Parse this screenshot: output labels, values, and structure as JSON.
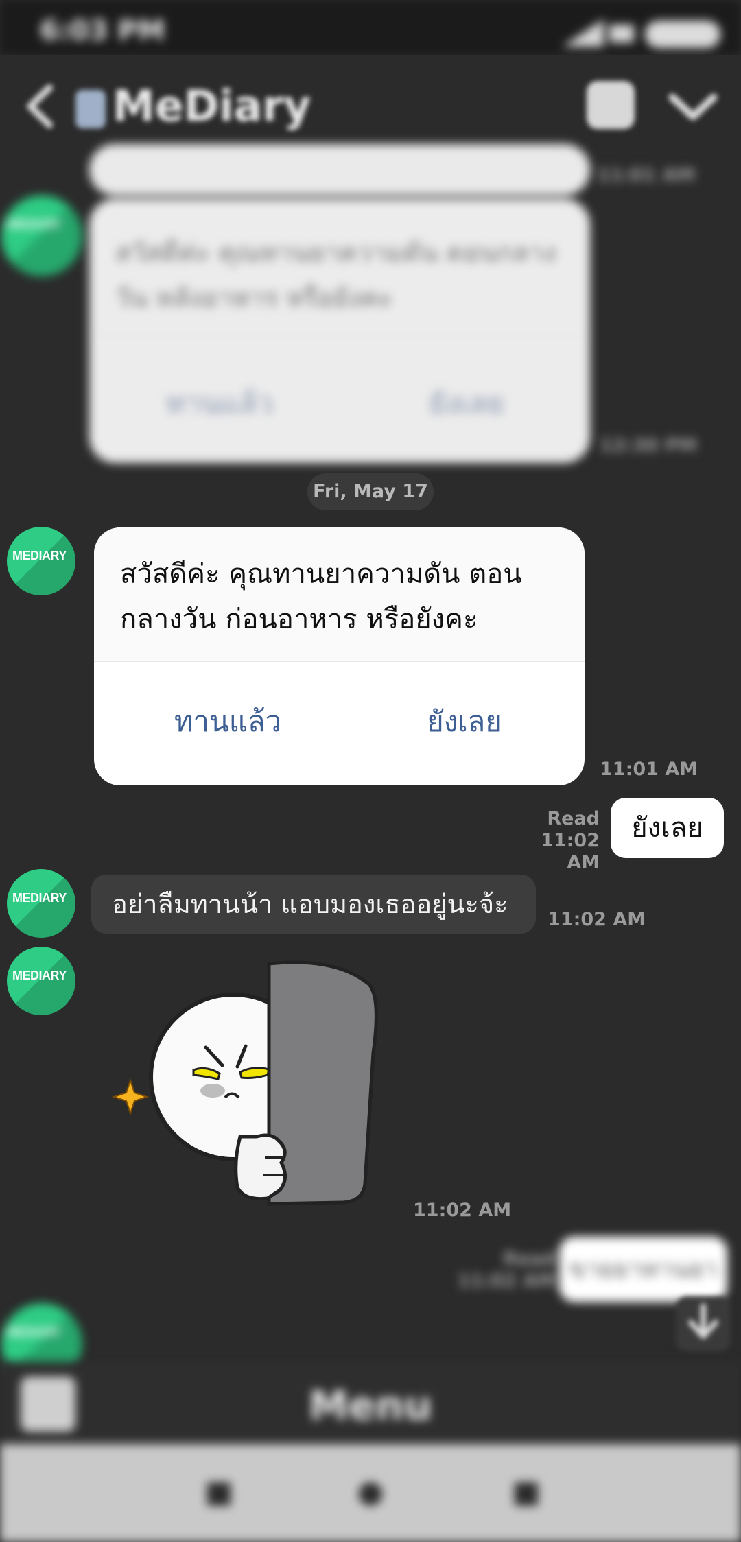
{
  "status_bar": {
    "time": "6:03 PM",
    "battery": "90"
  },
  "header": {
    "title": "MeDiary",
    "back_icon": "back-arrow-icon",
    "home_icon": "home-icon",
    "menu_icon": "chevron-down-icon"
  },
  "avatar_text": "MEDIARY",
  "prev_card": {
    "time_top": "11:01 AM",
    "message": "สวัสดีค่ะ คุณทานยาความดัน ตอนกลางวัน หลังอาหาร หรือยังคะ",
    "btn_yes": "ทานแล้ว",
    "btn_no": "ยังเลย",
    "time": "12:30 PM"
  },
  "date_separator": "Fri, May 17",
  "card": {
    "line1": "สวัสดีค่ะ คุณทานยาความดัน ตอน",
    "line2": "กลางวัน ก่อนอาหาร หรือยังคะ",
    "btn_yes": "ทานแล้ว",
    "btn_no": "ยังเลย",
    "time": "11:01 AM"
  },
  "reply": {
    "read": "Read",
    "time": "11:02 AM",
    "text": "ยังเลย"
  },
  "bot_message": {
    "text": "อย่าลืมทานน้า แอบมองเธออยู่นะจ้ะ",
    "time": "11:02 AM"
  },
  "sticker": {
    "name": "peeking-moon-sticker",
    "time": "11:02 AM"
  },
  "blurred_reply": {
    "read": "Read",
    "time": "11:02 AM",
    "text": "ขายยาทานยา"
  },
  "bottom": {
    "menu_label": "Menu"
  }
}
